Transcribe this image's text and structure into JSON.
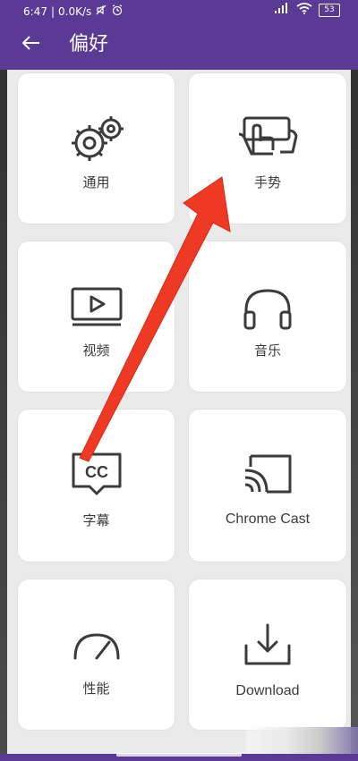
{
  "status_bar": {
    "time": "6:47",
    "separator": "|",
    "network_speed": "0.0K/s",
    "mute_icon": "mute-icon",
    "alarm_icon": "alarm-icon",
    "signal_icon": "signal-icon",
    "wifi_icon": "wifi-icon",
    "battery_level": "53"
  },
  "header": {
    "back_icon": "back-arrow-icon",
    "title": "偏好"
  },
  "cards": [
    {
      "label": "通用",
      "icon": "gears-icon"
    },
    {
      "label": "手势",
      "icon": "gesture-icon"
    },
    {
      "label": "视频",
      "icon": "video-icon"
    },
    {
      "label": "音乐",
      "icon": "headphones-icon"
    },
    {
      "label": "字幕",
      "icon": "subtitles-icon",
      "badge": "CC"
    },
    {
      "label": "Chrome Cast",
      "icon": "cast-icon"
    },
    {
      "label": "性能",
      "icon": "gauge-icon"
    },
    {
      "label": "Download",
      "icon": "download-icon"
    }
  ],
  "colors": {
    "accent": "#5b3a96",
    "card_background": "#ffffff",
    "page_background": "#eaeaea",
    "icon_color": "#3b3b3b",
    "annotation_arrow": "#ee3a24"
  }
}
